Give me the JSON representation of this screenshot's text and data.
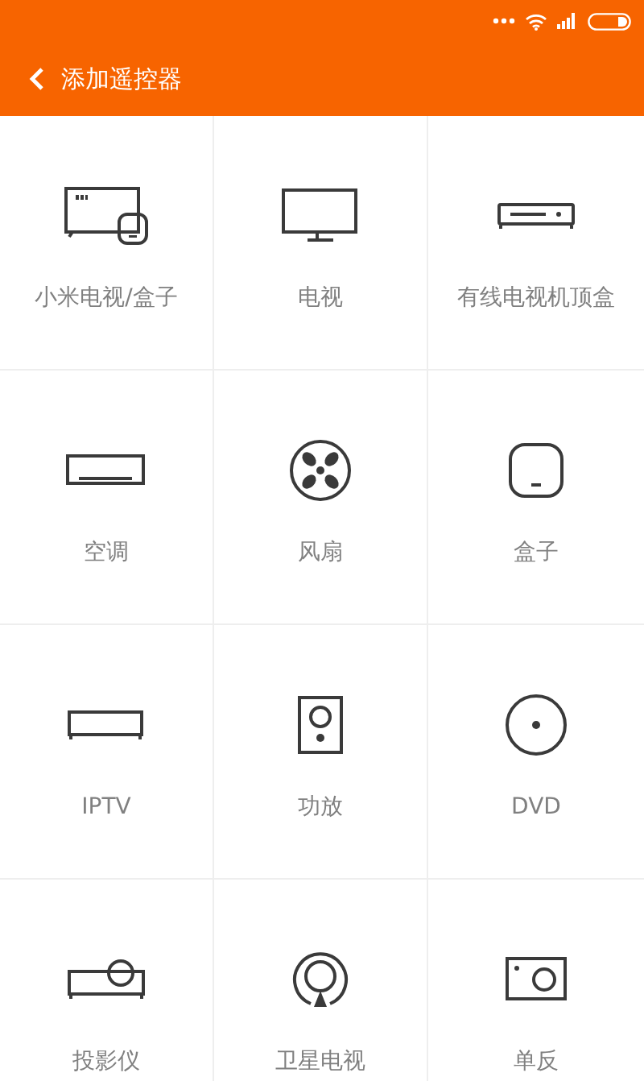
{
  "header": {
    "title": "添加遥控器"
  },
  "devices": [
    {
      "label": "小米电视/盒子",
      "kind": "mitv"
    },
    {
      "label": "电视",
      "kind": "tv"
    },
    {
      "label": "有线电视机顶盒",
      "kind": "stb"
    },
    {
      "label": "空调",
      "kind": "ac"
    },
    {
      "label": "风扇",
      "kind": "fan"
    },
    {
      "label": "盒子",
      "kind": "box"
    },
    {
      "label": "IPTV",
      "kind": "iptv"
    },
    {
      "label": "功放",
      "kind": "speaker"
    },
    {
      "label": "DVD",
      "kind": "dvd"
    },
    {
      "label": "投影仪",
      "kind": "projector"
    },
    {
      "label": "卫星电视",
      "kind": "satellite"
    },
    {
      "label": "单反",
      "kind": "camera"
    }
  ]
}
